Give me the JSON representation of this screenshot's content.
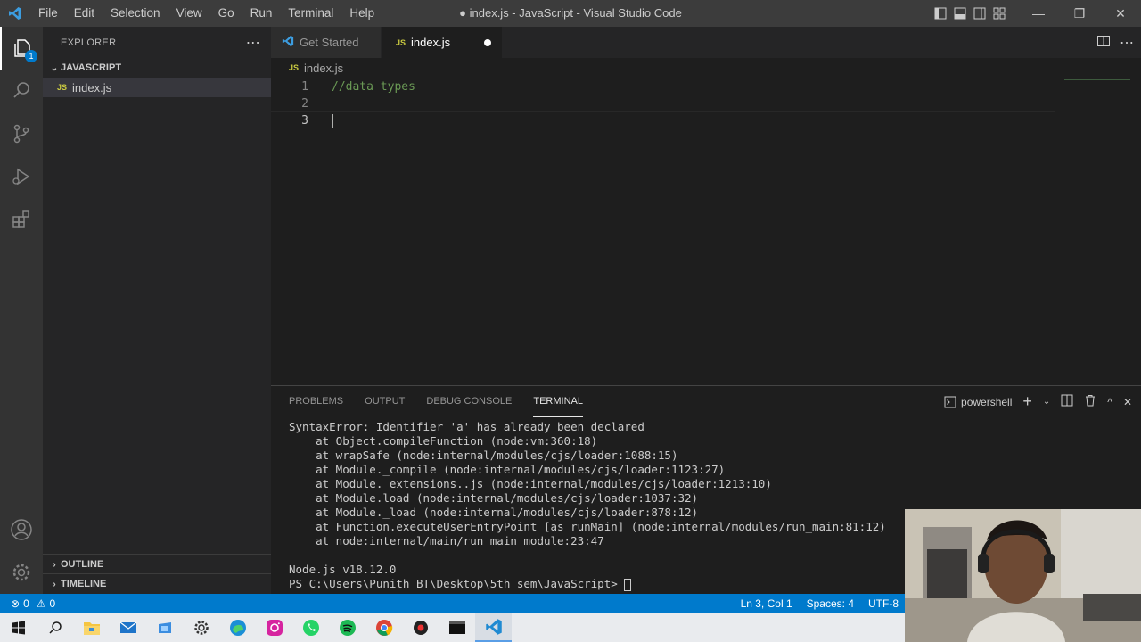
{
  "window": {
    "title": "● index.js - JavaScript - Visual Studio Code",
    "menu": [
      "File",
      "Edit",
      "Selection",
      "View",
      "Go",
      "Run",
      "Terminal",
      "Help"
    ]
  },
  "activity_bar": {
    "explorer_badge": "1",
    "items": [
      "files-icon",
      "search-icon",
      "source-control-icon",
      "run-debug-icon",
      "extensions-icon",
      "account-icon",
      "settings-gear-icon"
    ]
  },
  "sidebar": {
    "title": "EXPLORER",
    "folder": "JAVASCRIPT",
    "files": [
      {
        "icon": "JS",
        "name": "index.js"
      }
    ],
    "outline": "OUTLINE",
    "timeline": "TIMELINE"
  },
  "tabs": [
    {
      "label": "Get Started",
      "active": false
    },
    {
      "label": "index.js",
      "icon": "JS",
      "active": true,
      "dirty": true
    }
  ],
  "breadcrumb": {
    "icon": "JS",
    "file": "index.js"
  },
  "editor": {
    "lines": [
      {
        "n": "1",
        "text": "//data types"
      },
      {
        "n": "2",
        "text": ""
      },
      {
        "n": "3",
        "text": ""
      }
    ]
  },
  "panel": {
    "tabs": [
      "PROBLEMS",
      "OUTPUT",
      "DEBUG CONSOLE",
      "TERMINAL"
    ],
    "active_tab": "TERMINAL",
    "shell": "powershell",
    "terminal_lines": [
      "SyntaxError: Identifier 'a' has already been declared",
      "    at Object.compileFunction (node:vm:360:18)",
      "    at wrapSafe (node:internal/modules/cjs/loader:1088:15)",
      "    at Module._compile (node:internal/modules/cjs/loader:1123:27)",
      "    at Module._extensions..js (node:internal/modules/cjs/loader:1213:10)",
      "    at Module.load (node:internal/modules/cjs/loader:1037:32)",
      "    at Module._load (node:internal/modules/cjs/loader:878:12)",
      "    at Function.executeUserEntryPoint [as runMain] (node:internal/modules/run_main:81:12)",
      "    at node:internal/main/run_main_module:23:47",
      "",
      "Node.js v18.12.0",
      "PS C:\\Users\\Punith BT\\Desktop\\5th sem\\JavaScript> "
    ]
  },
  "status_bar": {
    "errors": "0",
    "warnings": "0",
    "position": "Ln 3, Col 1",
    "spaces": "Spaces: 4",
    "encoding": "UTF-8"
  },
  "taskbar": [
    "windows-start-icon",
    "search-icon",
    "file-explorer-icon",
    "mail-icon",
    "store-icon",
    "settings-icon",
    "edge-icon",
    "instagram-icon",
    "whatsapp-icon",
    "spotify-icon",
    "chrome-icon",
    "recorder-icon",
    "terminal-icon",
    "vscode-icon"
  ],
  "colors": {
    "accent": "#007acc",
    "comment": "#6a9955",
    "js_badge": "#cbcb41"
  }
}
